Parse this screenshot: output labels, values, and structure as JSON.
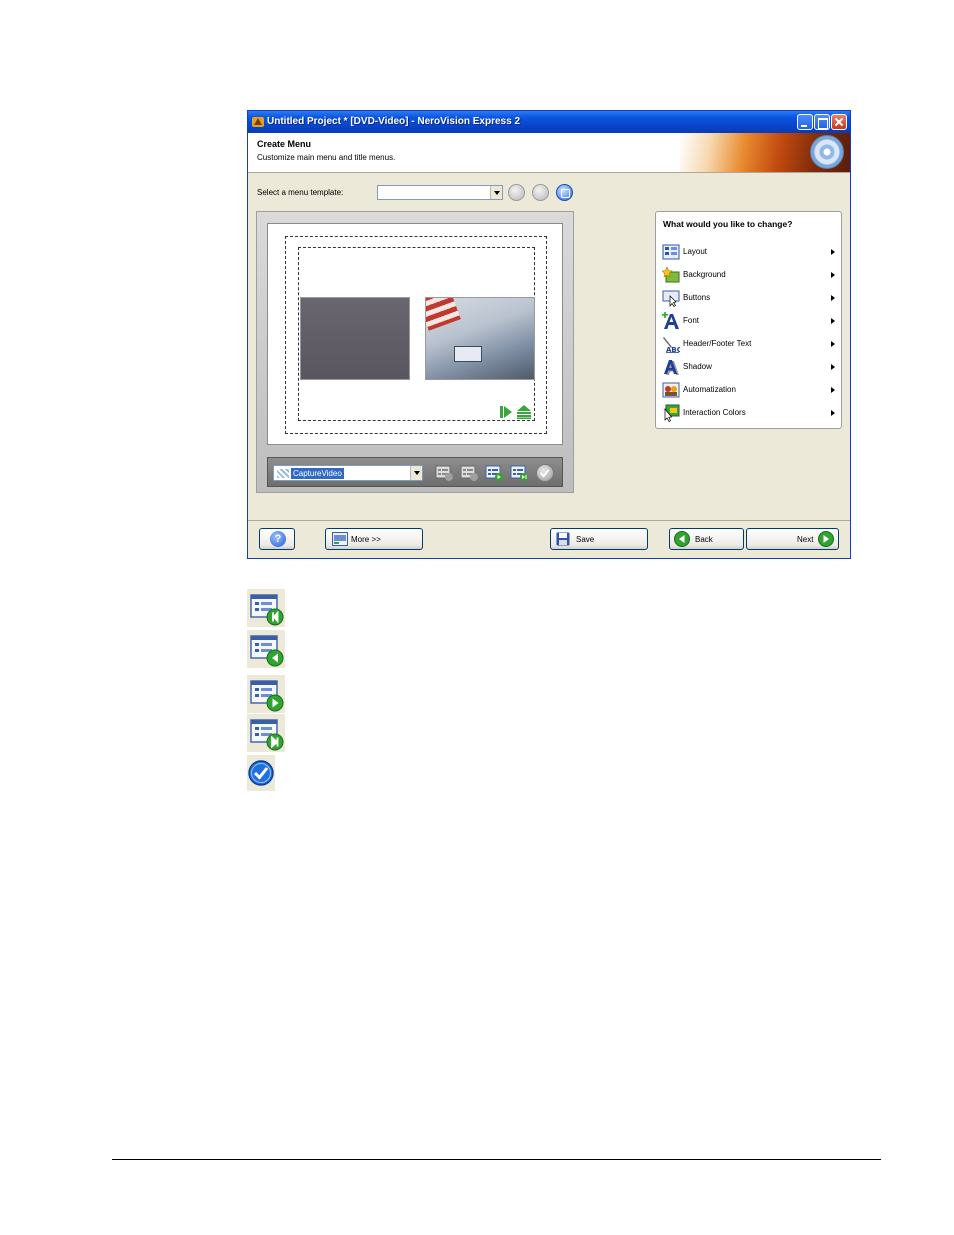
{
  "window": {
    "title": "Untitled Project * [DVD-Video] - NeroVision Express 2"
  },
  "header": {
    "title": "Create Menu",
    "subtitle": "Customize main menu and title menus."
  },
  "template": {
    "label": "Select a menu template:",
    "value": ""
  },
  "preview": {
    "menu_select_value": "CaptureVideo"
  },
  "change_panel": {
    "title": "What would you like to change?",
    "options": [
      {
        "label": "Layout",
        "icon": "layout-icon"
      },
      {
        "label": "Background",
        "icon": "background-icon"
      },
      {
        "label": "Buttons",
        "icon": "buttons-icon"
      },
      {
        "label": "Font",
        "icon": "font-icon"
      },
      {
        "label": "Header/Footer Text",
        "icon": "header-footer-text-icon"
      },
      {
        "label": "Shadow",
        "icon": "shadow-icon"
      },
      {
        "label": "Automatization",
        "icon": "automatization-icon"
      },
      {
        "label": "Interaction Colors",
        "icon": "interaction-colors-icon"
      }
    ]
  },
  "footer": {
    "more_label": "More >>",
    "save_label": "Save",
    "back_label": "Back",
    "next_label": "Next"
  },
  "colors": {
    "titlebar": "#0a55df",
    "window_bg": "#ece9d8",
    "accent_green": "#2fa52f"
  }
}
